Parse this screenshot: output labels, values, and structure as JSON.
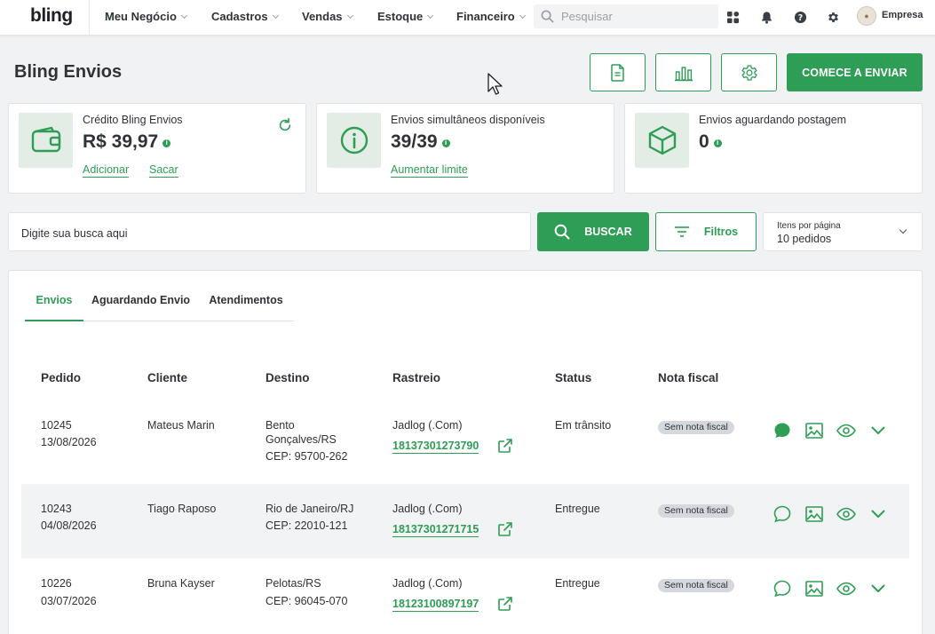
{
  "nav": {
    "logo": "bling",
    "items": [
      {
        "label": "Meu Negócio"
      },
      {
        "label": "Cadastros"
      },
      {
        "label": "Vendas"
      },
      {
        "label": "Estoque"
      },
      {
        "label": "Financeiro"
      }
    ],
    "search_placeholder": "Pesquisar",
    "company": "Empresa",
    "icons": [
      "apps-icon",
      "bell-icon",
      "help-icon",
      "gear-icon"
    ]
  },
  "page": {
    "title": "Bling Envios",
    "primary_button": "COMECE A ENVIAR"
  },
  "cards": {
    "credito": {
      "label": "Crédito Bling Envios",
      "value": "R$ 39,97",
      "link1": "Adicionar",
      "link2": "Sacar"
    },
    "simultaneos": {
      "label": "Envios simultâneos disponíveis",
      "value": "39/39",
      "link1": "Aumentar limite"
    },
    "aguardando": {
      "label": "Envios aguardando postagem",
      "value": "0"
    }
  },
  "filters": {
    "search_placeholder": "Digite sua busca aqui",
    "buscar_label": "BUSCAR",
    "filtros_label": "Filtros",
    "per_page_label": "Itens por página",
    "per_page_value": "10 pedidos"
  },
  "tabs": [
    {
      "label": "Envios",
      "active": true
    },
    {
      "label": "Aguardando Envio"
    },
    {
      "label": "Atendimentos"
    }
  ],
  "table": {
    "headers": {
      "pedido": "Pedido",
      "cliente": "Cliente",
      "destino": "Destino",
      "rastreio": "Rastreio",
      "status": "Status",
      "nota": "Nota fiscal"
    },
    "rows": [
      {
        "pedido": "10245",
        "data": "13/08/2026",
        "cliente": "Mateus Marin",
        "destino_l1": "Bento",
        "destino_l2": "Gonçalves/RS",
        "cep": "CEP: 95700-262",
        "carrier": "Jadlog (.Com)",
        "tracking": "18137301273790",
        "status": "Em trânsito",
        "nota": "Sem nota fiscal",
        "chat_filled": true
      },
      {
        "pedido": "10243",
        "data": "04/08/2026",
        "cliente": "Tiago Raposo",
        "destino_l1": "Rio de Janeiro/RJ",
        "cep": "CEP: 22010-121",
        "carrier": "Jadlog (.Com)",
        "tracking": "18137301271715",
        "status": "Entregue",
        "nota": "Sem nota fiscal",
        "chat_filled": false
      },
      {
        "pedido": "10226",
        "data": "03/07/2026",
        "cliente": "Bruna Kayser",
        "destino_l1": "Pelotas/RS",
        "cep": "CEP: 96045-070",
        "carrier": "Jadlog (.Com)",
        "tracking": "18123100897197",
        "status": "Entregue",
        "nota": "Sem nota fiscal",
        "chat_filled": false
      }
    ]
  },
  "colors": {
    "accent": "#2e9d55",
    "accent_light": "#e3ede5",
    "badge": "#d5d8dc",
    "row_alt": "#f1f3f5"
  }
}
